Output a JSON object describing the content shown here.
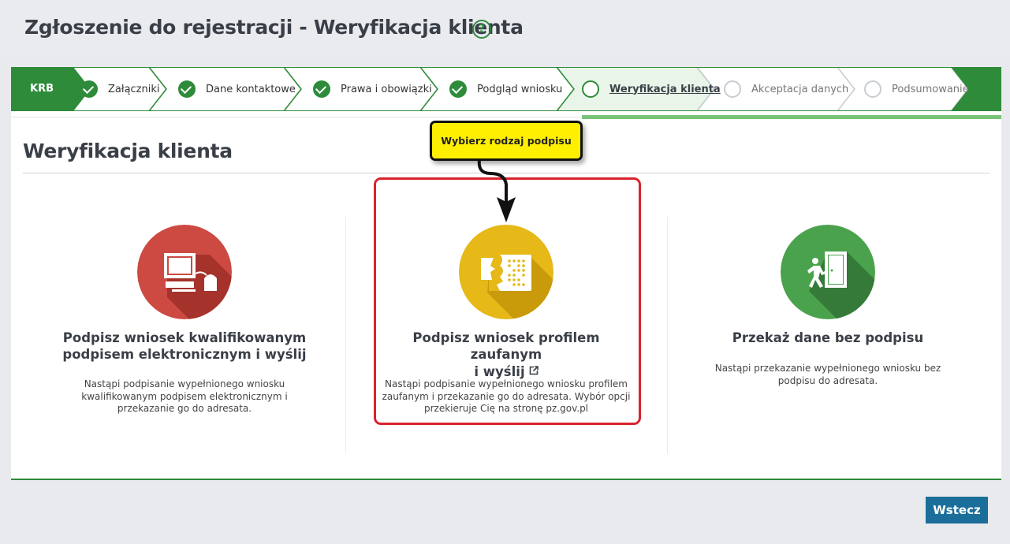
{
  "header": {
    "title": "Zgłoszenie do rejestracji - Weryfikacja klienta",
    "help_icon": "question-circle-icon"
  },
  "stepper": {
    "start_label": "KRB",
    "steps": [
      {
        "label": "Załączniki",
        "status": "done"
      },
      {
        "label": "Dane kontaktowe",
        "status": "done"
      },
      {
        "label": "Prawa i obowiązki",
        "status": "done"
      },
      {
        "label": "Podgląd wniosku",
        "status": "done"
      },
      {
        "label": "Weryfikacja klienta",
        "status": "current"
      },
      {
        "label": "Akceptacja danych",
        "status": "todo"
      },
      {
        "label": "Podsumowanie",
        "status": "todo"
      }
    ],
    "colors": {
      "done": "#2e8b3a",
      "current_fill": "#e8f5e8",
      "todo": "#c8cdd3"
    }
  },
  "main": {
    "title": "Weryfikacja klienta",
    "callout": "Wybierz rodzaj podpisu",
    "options": [
      {
        "title": "Podpisz wniosek kwalifikowanym podpisem elektronicznym i wyślij",
        "description": "Nastąpi podpisanie wypełnionego wniosku kwalifikowanym podpisem elektronicznym i przekazanie go do adresata.",
        "icon": "computer-card-reader-icon",
        "color": "#cc4a42"
      },
      {
        "title_line1": "Podpisz wniosek profilem zaufanym",
        "title_line2": "i wyślij",
        "description": "Nastąpi podpisanie wypełnionego wniosku profilem zaufanym i przekazanie go do adresata. Wybór opcji przekieruje Cię na stronę pz.gov.pl",
        "icon": "trusted-profile-icon",
        "color": "#e6b818",
        "highlighted": true
      },
      {
        "title": "Przekaż dane bez podpisu",
        "description": "Nastąpi przekazanie wypełnionego wniosku bez podpisu do adresata.",
        "icon": "exit-door-icon",
        "color": "#4aa24c"
      }
    ]
  },
  "footer": {
    "back_label": "Wstecz"
  }
}
